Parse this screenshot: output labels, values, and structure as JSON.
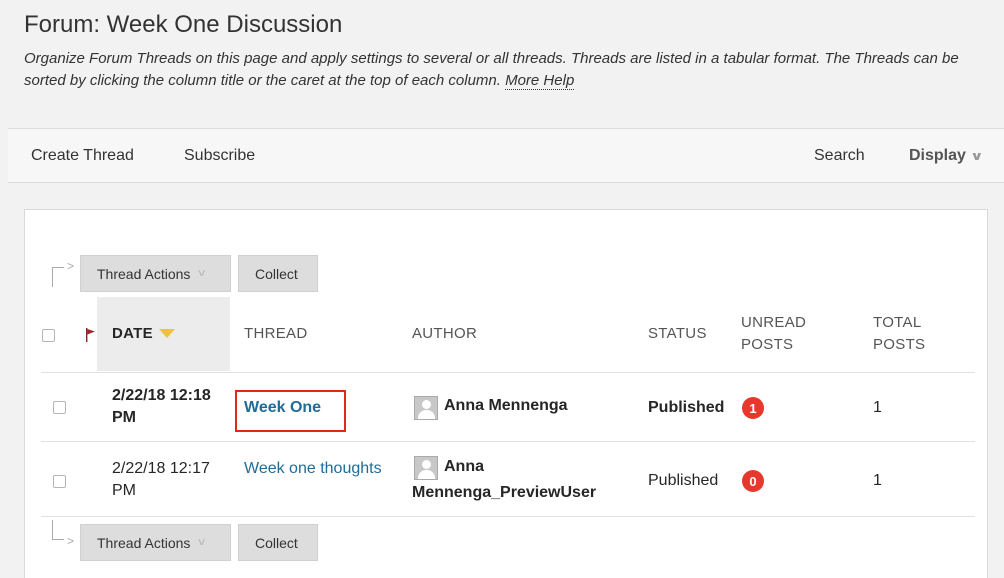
{
  "page": {
    "title": "Forum: Week One Discussion",
    "description": "Organize Forum Threads on this page and apply settings to several or all threads. Threads are listed in a tabular format. The Threads can be sorted by clicking the column title or the caret at the top of each column.",
    "more_help": "More Help"
  },
  "action_bar": {
    "create_thread": "Create Thread",
    "subscribe": "Subscribe",
    "search": "Search",
    "display": "Display"
  },
  "table_actions": {
    "thread_actions": "Thread Actions",
    "collect": "Collect"
  },
  "columns": {
    "date": "DATE",
    "thread": "THREAD",
    "author": "AUTHOR",
    "status": "STATUS",
    "unread_line1": "UNREAD",
    "unread_line2": "POSTS",
    "total_line1": "TOTAL",
    "total_line2": "POSTS"
  },
  "rows": [
    {
      "date_line1": "2/22/18 12:18",
      "date_line2": "PM",
      "thread": "Week One",
      "author_line1": "Anna Mennenga",
      "author_line2": "",
      "status": "Published",
      "unread": "1",
      "total": "1"
    },
    {
      "date_line1": "2/22/18 12:17",
      "date_line2": "PM",
      "thread": "Week one thoughts",
      "author_line1": "Anna",
      "author_line2": "Mennenga_PreviewUser",
      "status": "Published",
      "unread": "0",
      "total": "1"
    }
  ],
  "colors": {
    "link": "#1f6b99",
    "badge": "#e8372c",
    "highlight_box": "#e02a14",
    "sort_caret": "#f0c040"
  },
  "icons": [
    "flag-icon",
    "sort-caret-down-icon",
    "chevron-down-icon",
    "avatar-icon",
    "bracket-arrow-icon"
  ]
}
